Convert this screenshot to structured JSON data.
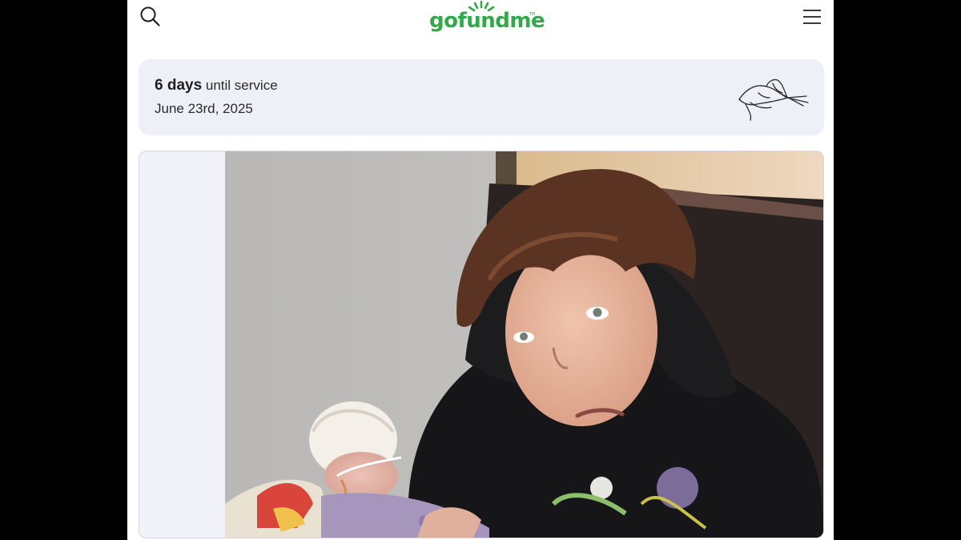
{
  "header": {
    "logo_text": "gofundme",
    "logo_tm": "TM",
    "search_icon": "search-icon",
    "menu_icon": "hamburger-menu-icon"
  },
  "service": {
    "days": "6 days",
    "until_text": "until service",
    "date": "June 23rd, 2025",
    "icon": "lily-flower-icon"
  },
  "photo": {
    "description_icon": "campaign-photo"
  },
  "colors": {
    "brand_green": "#32a84a",
    "card_bg": "#eef0f8",
    "frame_bg": "#f2f3fa",
    "outer_bg": "#000000"
  }
}
